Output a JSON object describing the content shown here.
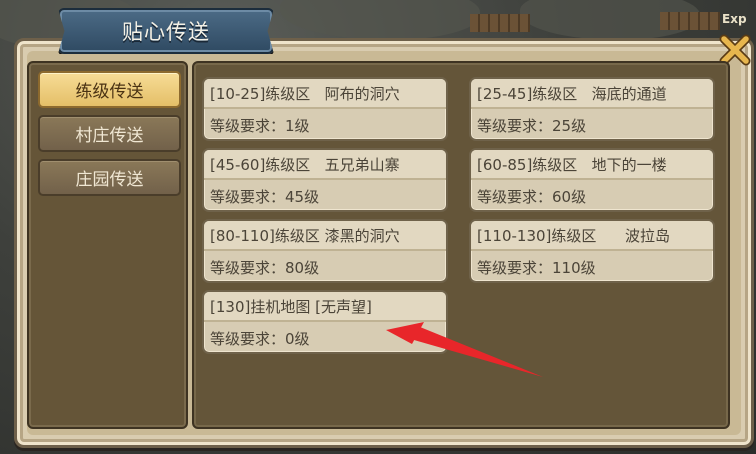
{
  "window": {
    "title": "贴心传送",
    "corner_label": "Exp"
  },
  "sidebar": {
    "items": [
      {
        "label": "练级传送",
        "active": true
      },
      {
        "label": "村庄传送",
        "active": false
      },
      {
        "label": "庄园传送",
        "active": false
      }
    ]
  },
  "destinations": [
    {
      "title": "[10-25]练级区   阿布的洞穴",
      "requirement": "等级要求：1级"
    },
    {
      "title": "[25-45]练级区   海底的通道",
      "requirement": "等级要求：25级"
    },
    {
      "title": "[45-60]练级区   五兄弟山寨",
      "requirement": "等级要求：45级"
    },
    {
      "title": "[60-85]练级区   地下的一楼",
      "requirement": "等级要求：60级"
    },
    {
      "title": "[80-110]练级区 漆黑的洞穴",
      "requirement": "等级要求：80级"
    },
    {
      "title": "[110-130]练级区      波拉岛",
      "requirement": "等级要求：110级"
    },
    {
      "title": "[130]挂机地图 [无声望]",
      "requirement": "等级要求：0级"
    }
  ],
  "colors": {
    "title_banner": "#3d5b76",
    "active_tab": "#f0d184",
    "card_bg": "#d7ccb3",
    "panel_bg": "#645539",
    "annotation_arrow": "#e8262a"
  },
  "icons": {
    "close": "close-x-icon",
    "annotation": "red-arrow-annotation"
  }
}
